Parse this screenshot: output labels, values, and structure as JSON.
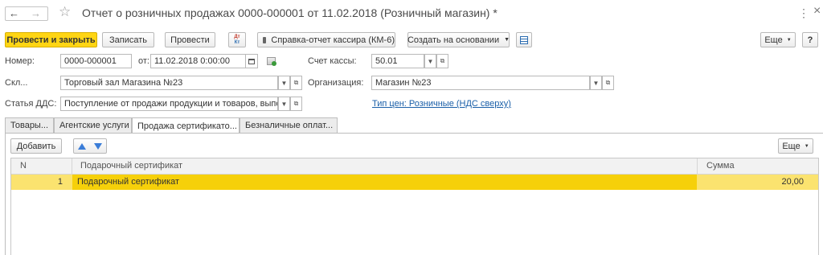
{
  "window": {
    "title": "Отчет о розничных продажах 0000-000001 от 11.02.2018 (Розничный магазин) *",
    "back_glyph": "←",
    "forward_glyph": "→",
    "star_glyph": "☆",
    "menu_glyph": "⋮",
    "close_glyph": "×"
  },
  "toolbar": {
    "post_close": "Провести и закрыть",
    "save": "Записать",
    "post": "Провести",
    "dt_kt_top": "Дт",
    "dt_kt_bottom": "Кт",
    "cashier_report": "Справка-отчет кассира (КМ-6)",
    "create_based_on": "Создать на основании",
    "more": "Еще",
    "help": "?"
  },
  "form": {
    "number_label": "Номер:",
    "number_value": "0000-000001",
    "from_label": "от:",
    "date_value": "11.02.2018  0:00:00",
    "cash_account_label": "Счет кассы:",
    "cash_account_value": "50.01",
    "warehouse_label": "Скл...",
    "warehouse_value": "Торговый зал Магазина №23",
    "organization_label": "Организация:",
    "organization_value": "Магазин №23",
    "dds_label": "Статья ДДС:",
    "dds_value": "Поступление от продажи продукции и товаров, выполнен",
    "price_type_link": "Тип цен: Розничные (НДС сверху)"
  },
  "tabs": [
    {
      "label": "Товары..."
    },
    {
      "label": "Агентские услуги"
    },
    {
      "label": "Продажа сертификато..."
    },
    {
      "label": "Безналичные оплат..."
    }
  ],
  "table_toolbar": {
    "add": "Добавить",
    "more": "Еще"
  },
  "table": {
    "headers": [
      "N",
      "Подарочный сертификат",
      "Сумма"
    ],
    "rows": [
      {
        "n": "1",
        "certificate": "Подарочный сертификат",
        "amount": "20,00"
      }
    ]
  },
  "colors": {
    "accent": "#ffd514",
    "selected_row": "#fbe36f",
    "selected_cell": "#f6d00a",
    "link": "#1a5fa8"
  }
}
